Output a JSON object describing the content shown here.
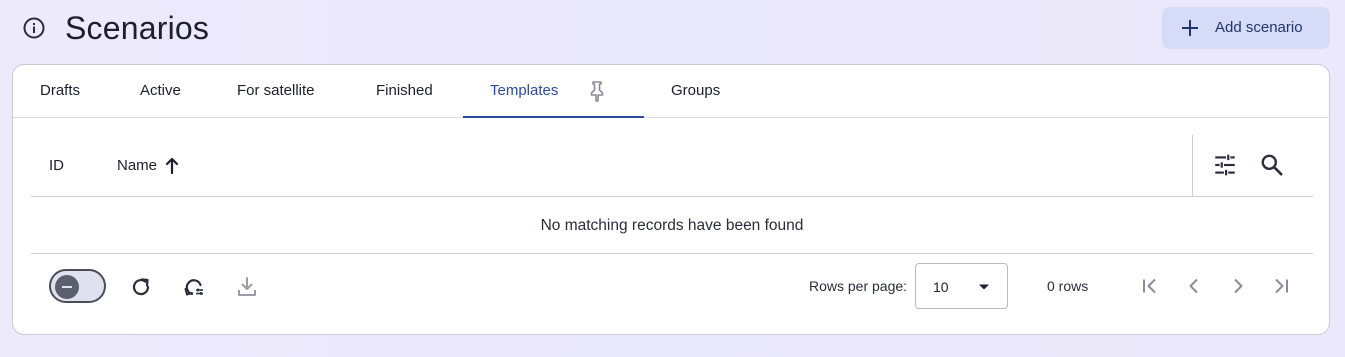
{
  "header": {
    "title": "Scenarios",
    "info_icon": "info-circle-icon",
    "add_button": {
      "label": "Add scenario",
      "icon": "plus-icon"
    }
  },
  "tabs": [
    {
      "label": "Drafts",
      "active": false
    },
    {
      "label": "Active",
      "active": false
    },
    {
      "label": "For satellite",
      "active": false
    },
    {
      "label": "Finished",
      "active": false
    },
    {
      "label": "Templates",
      "active": true,
      "pinned": true
    },
    {
      "label": "Groups",
      "active": false
    }
  ],
  "table": {
    "columns": [
      {
        "label": "ID"
      },
      {
        "label": "Name",
        "sort": "ascending"
      }
    ],
    "tools": [
      "column-settings-icon",
      "search-icon"
    ],
    "empty_message": "No matching records have been found"
  },
  "footer": {
    "toggle_state": "off",
    "actions": [
      "refresh-icon",
      "auto-refresh-icon",
      "download-icon"
    ],
    "rows_per_page_label": "Rows per page:",
    "rows_per_page_value": "10",
    "rows_count": "0 rows",
    "pagination": [
      "first-page-icon",
      "previous-page-icon",
      "next-page-icon",
      "last-page-icon"
    ]
  },
  "colors": {
    "accent": "#2e4a9e",
    "add_button_bg": "#d6dcf7",
    "page_bg": "#eceafb"
  }
}
